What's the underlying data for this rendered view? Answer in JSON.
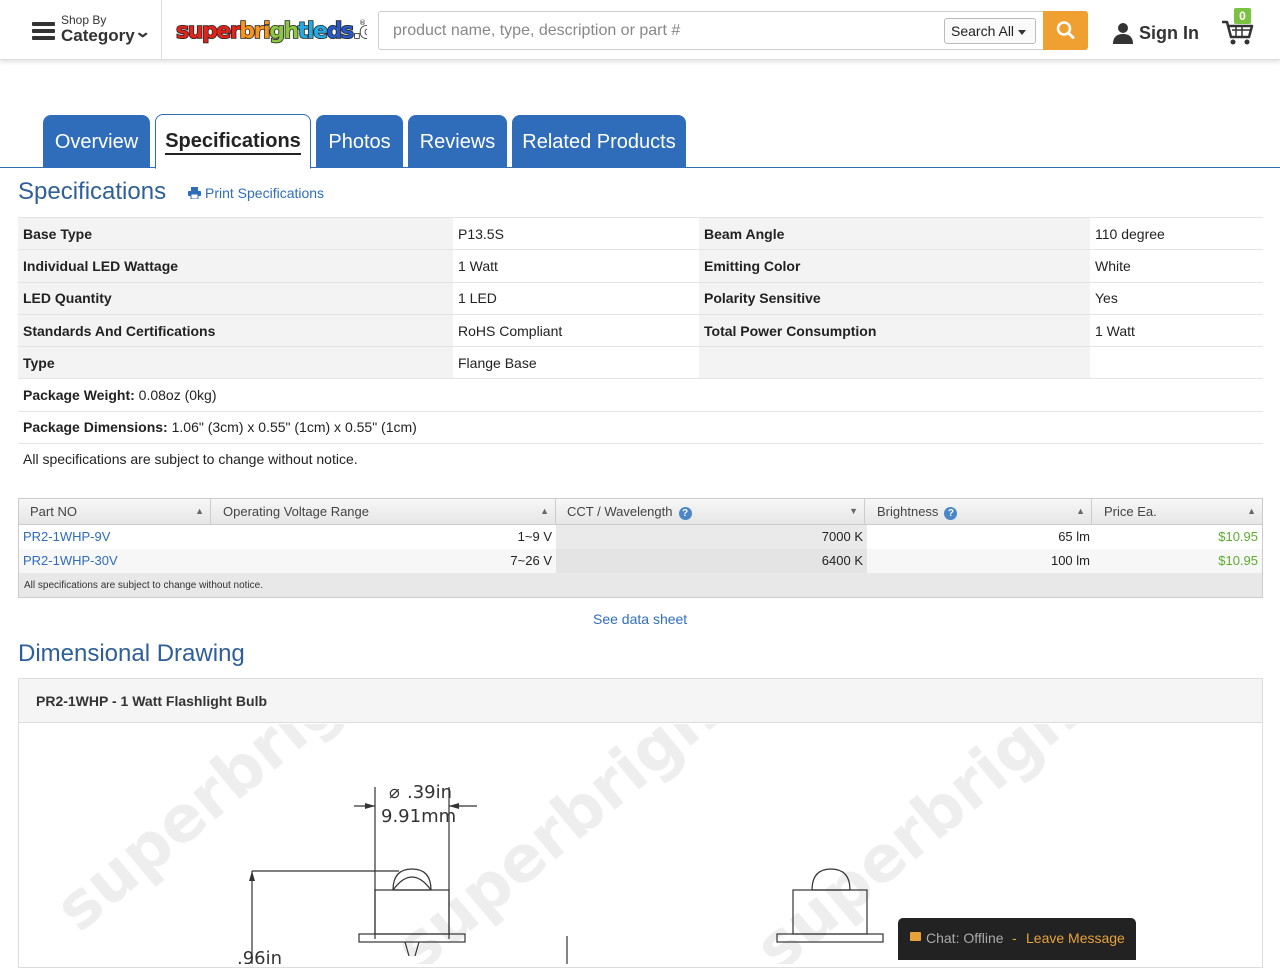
{
  "header": {
    "shop_by_small": "Shop By",
    "shop_by_big": "Category",
    "logo": "superbrightleds.com",
    "search_placeholder": "product name, type, description or part #",
    "search_scope": "Search All",
    "sign_in": "Sign In",
    "cart_count": "0",
    "accent_color": "#f0a030"
  },
  "tabs": [
    {
      "label": "Overview"
    },
    {
      "label": "Specifications"
    },
    {
      "label": "Photos"
    },
    {
      "label": "Reviews"
    },
    {
      "label": "Related Products"
    }
  ],
  "specs": {
    "title": "Specifications",
    "print_label": "Print Specifications",
    "rows": [
      {
        "k1": "Base Type",
        "v1": "P13.5S",
        "k2": "Beam Angle",
        "v2": "110 degree"
      },
      {
        "k1": "Individual LED Wattage",
        "v1": "1 Watt",
        "k2": "Emitting Color",
        "v2": "White"
      },
      {
        "k1": "LED Quantity",
        "v1": "1 LED",
        "k2": "Polarity Sensitive",
        "v2": "Yes"
      },
      {
        "k1": "Standards And Certifications",
        "v1": "RoHS Compliant",
        "k2": "Total Power Consumption",
        "v2": "1 Watt"
      },
      {
        "k1": "Type",
        "v1": "Flange Base",
        "k2": "",
        "v2": ""
      }
    ],
    "package_weight_label": "Package Weight:",
    "package_weight": "0.08oz (0kg)",
    "package_dim_label": "Package Dimensions:",
    "package_dim": "1.06\" (3cm) x 0.55\" (1cm) x 0.55\" (1cm)",
    "notice": "All specifications are subject to change without notice."
  },
  "parts": {
    "headers": [
      "Part NO",
      "Operating Voltage Range",
      "CCT / Wavelength",
      "Brightness",
      "Price Ea."
    ],
    "rows": [
      {
        "part": "PR2-1WHP-9V",
        "voltage": "1~9 V",
        "cct": "7000 K",
        "brightness": "65 lm",
        "price": "$10.95"
      },
      {
        "part": "PR2-1WHP-30V",
        "voltage": "7~26 V",
        "cct": "6400 K",
        "brightness": "100 lm",
        "price": "$10.95"
      }
    ],
    "note": "All specifications are subject to change without notice.",
    "datasheet": "See data sheet"
  },
  "dimensional": {
    "title": "Dimensional Drawing",
    "panel_title": "PR2-1WHP - 1 Watt Flashlight Bulb",
    "dim_in": ".39in",
    "dim_mm": "9.91mm",
    "dim_side": ".96in"
  },
  "chat": {
    "status": "Chat: Offline",
    "separator": "-",
    "action": "Leave Message"
  }
}
